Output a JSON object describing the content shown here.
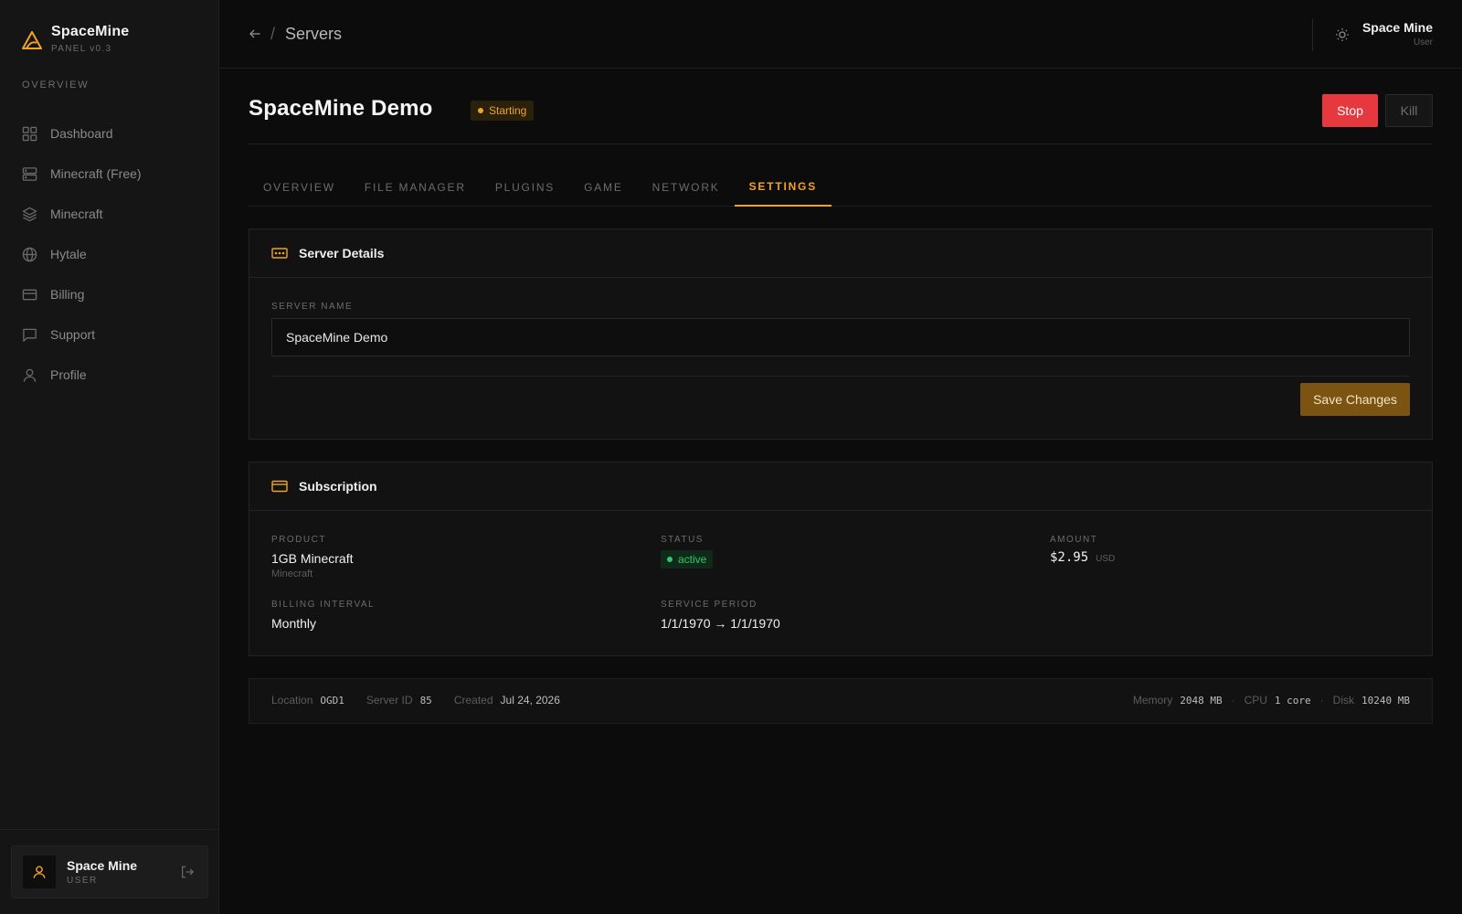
{
  "brand": {
    "name": "SpaceMine",
    "version": "PANEL v0.3"
  },
  "sidebar": {
    "section_label": "OVERVIEW",
    "items": [
      {
        "label": "Dashboard",
        "icon": "dashboard-grid-icon"
      },
      {
        "label": "Minecraft (Free)",
        "icon": "server-icon"
      },
      {
        "label": "Minecraft",
        "icon": "layers-icon"
      },
      {
        "label": "Hytale",
        "icon": "globe-icon"
      },
      {
        "label": "Billing",
        "icon": "credit-card-icon"
      },
      {
        "label": "Support",
        "icon": "chat-icon"
      },
      {
        "label": "Profile",
        "icon": "user-icon"
      }
    ],
    "user": {
      "name": "Space Mine",
      "role": "USER"
    }
  },
  "topbar": {
    "separator": "/",
    "breadcrumb": "Servers",
    "user_name": "Space Mine",
    "user_role": "User"
  },
  "server": {
    "name": "SpaceMine Demo",
    "status": "Starting",
    "stop_label": "Stop",
    "kill_label": "Kill"
  },
  "tabs": [
    {
      "label": "OVERVIEW",
      "active": false
    },
    {
      "label": "FILE MANAGER",
      "active": false
    },
    {
      "label": "PLUGINS",
      "active": false
    },
    {
      "label": "GAME",
      "active": false
    },
    {
      "label": "NETWORK",
      "active": false
    },
    {
      "label": "SETTINGS",
      "active": true
    }
  ],
  "details": {
    "title": "Server Details",
    "name_label": "SERVER NAME",
    "name_value": "SpaceMine Demo",
    "save_label": "Save Changes"
  },
  "subscription": {
    "title": "Subscription",
    "product_label": "PRODUCT",
    "product_value": "1GB Minecraft",
    "product_sub": "Minecraft",
    "status_label": "STATUS",
    "status_value": "active",
    "amount_label": "AMOUNT",
    "amount_value": "$2.95",
    "amount_currency": "USD",
    "interval_label": "BILLING INTERVAL",
    "interval_value": "Monthly",
    "period_label": "SERVICE PERIOD",
    "period_value": "1/1/1970 → 1/1/1970"
  },
  "footer": {
    "location_label": "Location",
    "location_value": "OGD1",
    "id_label": "Server ID",
    "id_value": "85",
    "created_label": "Created",
    "created_value": "Jul 24, 2026",
    "memory_label": "Memory",
    "memory_value": "2048 MB",
    "cpu_label": "CPU",
    "cpu_value": "1 core",
    "disk_label": "Disk",
    "disk_value": "10240 MB",
    "dot": "·"
  },
  "colors": {
    "accent": "#f2a321",
    "danger": "#e5393f",
    "success": "#34c46a",
    "save_button": "#7a5410"
  }
}
